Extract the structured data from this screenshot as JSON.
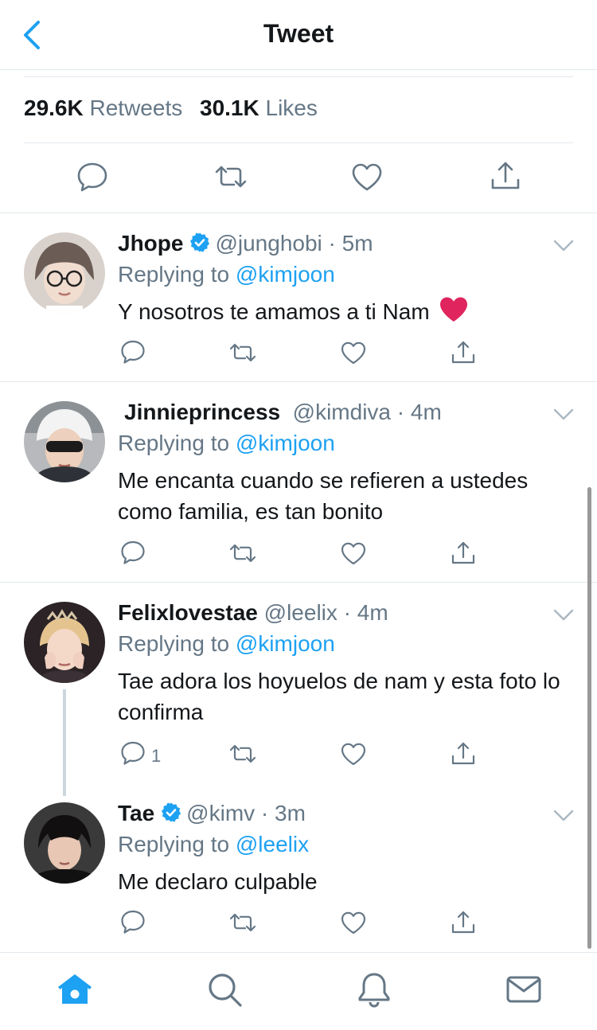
{
  "header": {
    "title": "Tweet"
  },
  "stats": {
    "retweets_count": "29.6K",
    "retweets_label": "Retweets",
    "likes_count": "30.1K",
    "likes_label": "Likes"
  },
  "colors": {
    "accent": "#1da1f2",
    "text": "#14171a",
    "muted": "#657786",
    "divider": "#e1e8ed",
    "heart": "#e0245e"
  },
  "replies": [
    {
      "name": "Jhope",
      "verified": true,
      "handle": "@junghobi",
      "time": "5m",
      "replying_prefix": "Replying to",
      "replying_to": "@kimjoon",
      "text": "Y nosotros te amamos a ti Nam",
      "emoji": "red-heart-emoji",
      "reply_count": ""
    },
    {
      "name": "Jinnieprincess",
      "verified": false,
      "handle": "@kimdiva",
      "time": "4m",
      "replying_prefix": "Replying to",
      "replying_to": "@kimjoon",
      "text": "Me encanta cuando se refieren a ustedes como familia, es tan bonito",
      "reply_count": ""
    },
    {
      "name": "Felixlovestae",
      "verified": false,
      "handle": "@leelix",
      "time": "4m",
      "replying_prefix": "Replying to",
      "replying_to": "@kimjoon",
      "text": "Tae adora los hoyuelos de nam y esta foto lo confirma",
      "reply_count": "1"
    },
    {
      "name": "Tae",
      "verified": true,
      "handle": "@kimv",
      "time": "3m",
      "replying_prefix": "Replying to",
      "replying_to": "@leelix",
      "text": "Me declaro culpable",
      "reply_count": ""
    }
  ],
  "tabbar": {
    "active": "home",
    "tabs": [
      "home-icon",
      "search-icon",
      "notifications-icon",
      "messages-icon"
    ]
  }
}
